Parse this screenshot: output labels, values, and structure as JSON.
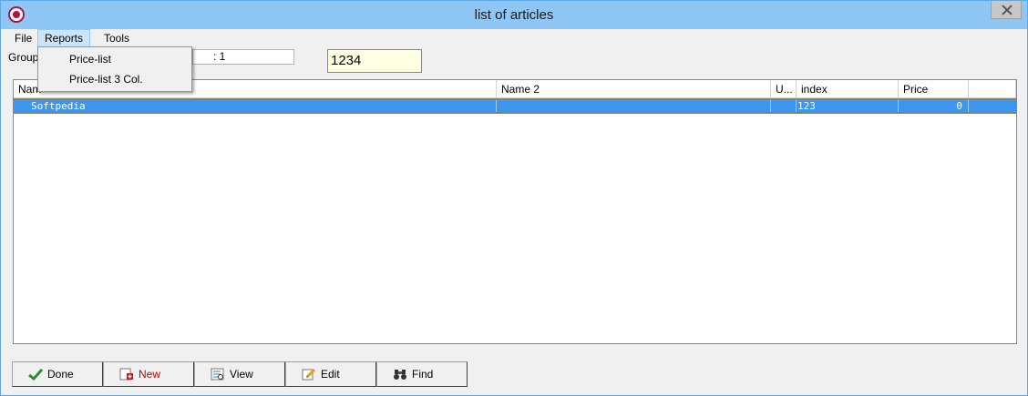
{
  "window": {
    "title": "list of articles"
  },
  "menu": {
    "file": "File",
    "reports": "Reports",
    "tools": "Tools"
  },
  "reports_menu": {
    "items": [
      "Price-list",
      "Price-list 3 Col."
    ]
  },
  "filter": {
    "group_label": "Group",
    "group_value": ": 1",
    "code_value": "1234"
  },
  "table": {
    "columns": [
      "Nam",
      "Name 2",
      "U...",
      "index",
      "Price"
    ],
    "rows": [
      {
        "name": "Softpedia",
        "name2": "",
        "unit": "",
        "index": "123",
        "price": "0"
      }
    ]
  },
  "buttons": {
    "done": "Done",
    "new": "New",
    "view": "View",
    "edit": "Edit",
    "find": "Find"
  },
  "colors": {
    "title_bar": "#8ec6f5",
    "selection": "#3c96ee",
    "new_label": "#c00000",
    "code_field_bg": "#ffffe1"
  },
  "icons": {
    "app": "app-logo-icon",
    "close": "close-icon",
    "done": "checkmark-icon",
    "new": "new-document-icon",
    "view": "view-report-icon",
    "edit": "edit-pencil-icon",
    "find": "binoculars-icon"
  }
}
